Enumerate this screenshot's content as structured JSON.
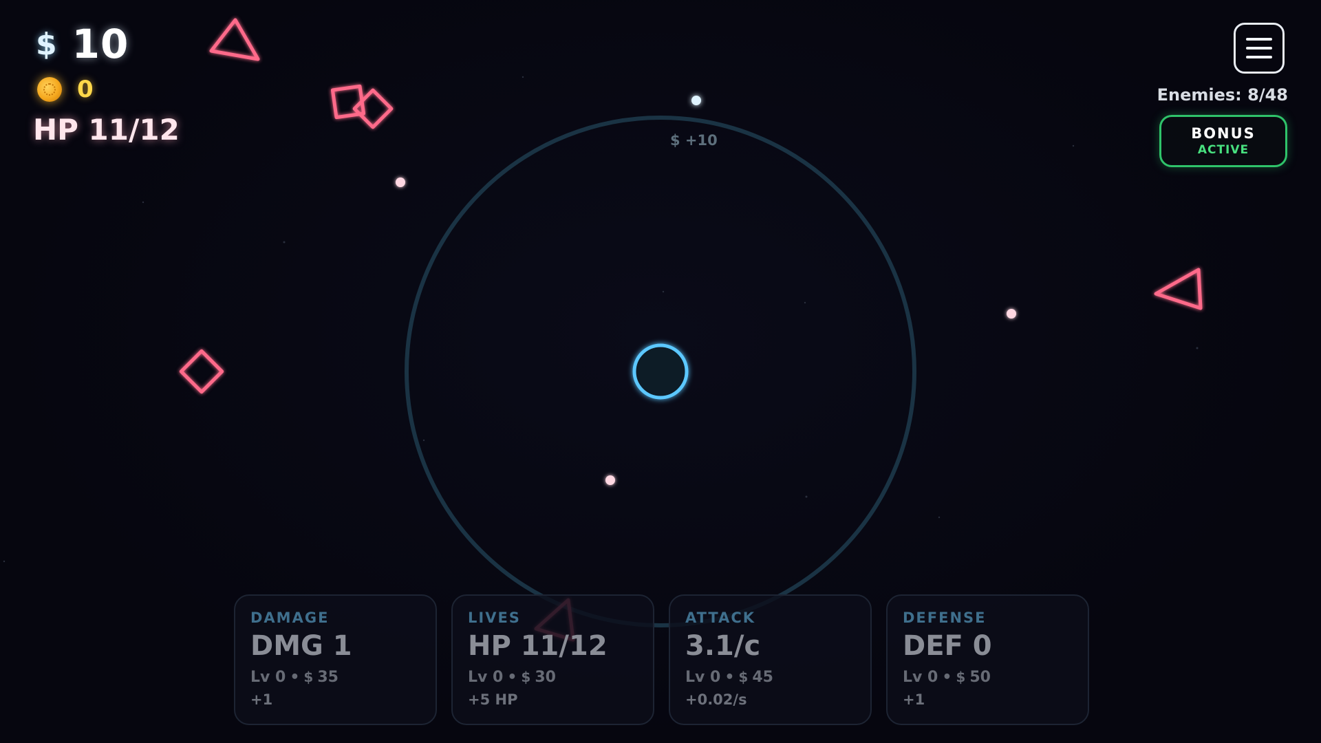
{
  "hud": {
    "currency_symbol": "$",
    "money": "10",
    "coins": "0",
    "hp": "HP 11/12"
  },
  "status": {
    "enemies": "Enemies: 8/48",
    "bonus_title": "BONUS",
    "bonus_state": "ACTIVE"
  },
  "field": {
    "reward_text": "$ +10"
  },
  "upgrades": [
    {
      "category": "DAMAGE",
      "value": "DMG 1",
      "level": "Lv 0",
      "cost_symbol": "$",
      "cost": "35",
      "bonus": "+1"
    },
    {
      "category": "LIVES",
      "value": "HP 11/12",
      "level": "Lv 0",
      "cost_symbol": "$",
      "cost": "30",
      "bonus": "+5 HP"
    },
    {
      "category": "ATTACK",
      "value": "3.1/c",
      "level": "Lv 0",
      "cost_symbol": "$",
      "cost": "45",
      "bonus": "+0.02/s"
    },
    {
      "category": "DEFENSE",
      "value": "DEF 0",
      "level": "Lv 0",
      "cost_symbol": "$",
      "cost": "50",
      "bonus": "+1"
    }
  ],
  "colors": {
    "enemy": "#ff6b8a",
    "player_core": "#5cc8ff",
    "range_ring": "#1a3344",
    "bonus_accent": "#2fc36a",
    "coin": "#f5a81e"
  },
  "icons": {
    "currency": "dollar-icon",
    "coin": "coin-icon",
    "menu": "hamburger-menu-icon"
  }
}
